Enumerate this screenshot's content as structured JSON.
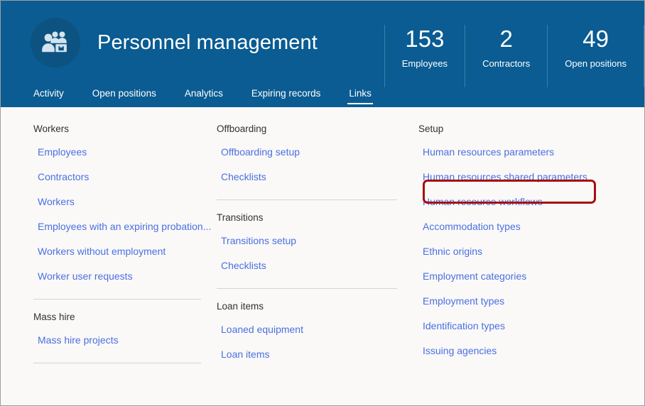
{
  "header": {
    "title": "Personnel management",
    "icon": "people-briefcase-icon",
    "background_color": "#0a5c92",
    "kpis": [
      {
        "value": "153",
        "label": "Employees"
      },
      {
        "value": "2",
        "label": "Contractors"
      },
      {
        "value": "49",
        "label": "Open positions"
      }
    ]
  },
  "tabs": [
    {
      "label": "Activity",
      "active": false
    },
    {
      "label": "Open positions",
      "active": false
    },
    {
      "label": "Analytics",
      "active": false
    },
    {
      "label": "Expiring records",
      "active": false
    },
    {
      "label": "Links",
      "active": true
    }
  ],
  "columns": [
    {
      "name": "column-one",
      "groups": [
        {
          "title": "Workers",
          "links": [
            "Employees",
            "Contractors",
            "Workers",
            "Employees with an expiring probation...",
            "Workers without employment",
            "Worker user requests"
          ],
          "divider_after": true
        },
        {
          "title": "Mass hire",
          "links": [
            "Mass hire projects"
          ],
          "divider_after": true
        }
      ]
    },
    {
      "name": "column-two",
      "groups": [
        {
          "title": "Offboarding",
          "links": [
            "Offboarding setup",
            "Checklists"
          ],
          "divider_after": true
        },
        {
          "title": "Transitions",
          "links": [
            "Transitions setup",
            "Checklists"
          ],
          "divider_after": true
        },
        {
          "title": "Loan items",
          "links": [
            "Loaned equipment",
            "Loan items"
          ],
          "divider_after": false
        }
      ]
    },
    {
      "name": "column-three",
      "groups": [
        {
          "title": "Setup",
          "links": [
            "Human resources parameters",
            "Human resources shared parameters",
            "Human resource workflows",
            "Accommodation types",
            "Ethnic origins",
            "Employment categories",
            "Employment types",
            "Identification types",
            "Issuing agencies"
          ],
          "divider_after": false
        }
      ]
    }
  ],
  "annotation": {
    "name": "highlight-human-resources-parameters",
    "color": "#a50e0e",
    "target": "Human resources parameters"
  },
  "colors": {
    "header_blue": "#0a5c92",
    "link_blue": "#4b6fe0",
    "content_background": "#faf9f8",
    "group_title": "#323130",
    "annotation_red": "#a50e0e"
  }
}
